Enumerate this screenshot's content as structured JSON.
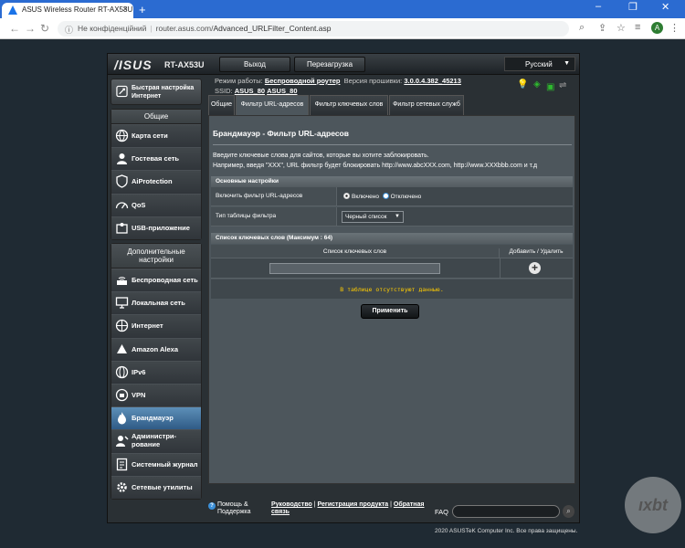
{
  "browser": {
    "tab_title": "ASUS Wireless Router RT-AX53U",
    "address_warning": "Не конфіденційний",
    "address_host": "router.asus.com/",
    "address_path": "Advanced_URLFilter_Content.asp",
    "profile_initial": "A"
  },
  "header": {
    "logo": "/ISUS",
    "model": "RT-AX53U",
    "logout": "Выход",
    "reboot": "Перезагрузка",
    "language": "Русский"
  },
  "status": {
    "mode_label": "Режим работы:",
    "mode_value": "Беспроводной роутер",
    "firmware_label": "Версия прошивки:",
    "firmware_value": "3.0.0.4.382_45213",
    "ssid_label": "SSID:",
    "ssid_1": "ASUS_80",
    "ssid_2": "ASUS_80"
  },
  "nav": {
    "quick_setup": "Быстрая настройка Интернет",
    "general_header": "Общие",
    "general": [
      "Карта сети",
      "Гостевая сеть",
      "AiProtection",
      "QoS",
      "USB-приложение"
    ],
    "advanced_header": "Дополнительные настройки",
    "advanced": [
      "Беспроводная сеть",
      "Локальная сеть",
      "Интернет",
      "Amazon Alexa",
      "IPv6",
      "VPN",
      "Брандмауэр",
      "Администри-рование",
      "Системный журнал",
      "Сетевые утилиты"
    ]
  },
  "tabs": [
    "Общие",
    "Фильтр URL-адресов",
    "Фильтр ключевых слов",
    "Фильтр сетевых служб"
  ],
  "content": {
    "title": "Брандмауэр - Фильтр URL-адресов",
    "desc1": "Введите ключевые слова для сайтов, которые вы хотите заблокировать.",
    "desc2": "Например, введя \"XXX\", URL фильтр будет блокировать http://www.abcXXX.com, http://www.XXXbbb.com и т.д",
    "basic_section": "Основные настройки",
    "enable_label": "Включить фильтр URL-адресов",
    "enabled": "Включено",
    "disabled": "Отключено",
    "table_type_label": "Тип таблицы фильтра",
    "table_type_value": "Черный список",
    "list_section": "Список ключевых слов (Максимум : 64)",
    "list_col": "Список ключевых слов",
    "addremove_col": "Добавить / Удалить",
    "empty": "В таблице отсутствуют данные.",
    "apply": "Применить"
  },
  "footer": {
    "help": "Помощь & Поддержка",
    "manual": "Руководство",
    "registration": "Регистрация продукта",
    "feedback": "Обратная связь",
    "faq": "FAQ",
    "copyright": "2020 ASUSTeK Computer Inc. Все права защищены."
  }
}
